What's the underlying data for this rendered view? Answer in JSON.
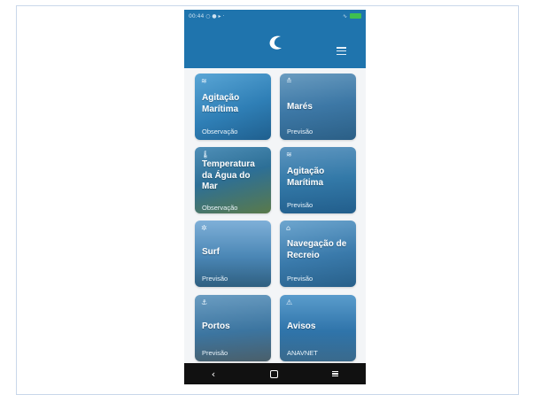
{
  "status_bar": {
    "time": "00:44",
    "left_icons": "○ ● ▸ ·",
    "right_icons": "∿"
  },
  "app": {
    "logo": "C",
    "menu_icon": "hamburger-icon"
  },
  "cards": [
    {
      "title": "Agitação Marítima",
      "subtitle": "Observação",
      "icon": "≋",
      "icon_name": "waves-icon",
      "color": "#2f7fb6"
    },
    {
      "title": "Marés",
      "subtitle": "Previsão",
      "icon": "≛",
      "icon_name": "tide-icon",
      "color": "#3d78a6"
    },
    {
      "title": "Temperatura da Água do Mar",
      "subtitle": "Observação",
      "icon": "🌡",
      "icon_name": "thermometer-icon",
      "color": "#2d6f96"
    },
    {
      "title": "Agitação Marítima",
      "subtitle": "Previsão",
      "icon": "≋",
      "icon_name": "waves-icon",
      "color": "#3379a8"
    },
    {
      "title": "Surf",
      "subtitle": "Previsão",
      "icon": "✲",
      "icon_name": "surf-icon",
      "color": "#4a86b5"
    },
    {
      "title": "Navegação de Recreio",
      "subtitle": "Previsão",
      "icon": "⌂",
      "icon_name": "boat-icon",
      "color": "#3a7aab"
    },
    {
      "title": "Portos",
      "subtitle": "Previsão",
      "icon": "⚓",
      "icon_name": "anchor-icon",
      "color": "#3c75a0"
    },
    {
      "title": "Avisos",
      "subtitle": "ANAVNET",
      "icon": "⚠",
      "icon_name": "warning-icon",
      "color": "#2f74aa"
    }
  ],
  "nav_bar": {
    "back": "‹",
    "home": "home-icon",
    "recents": "recents-icon"
  }
}
